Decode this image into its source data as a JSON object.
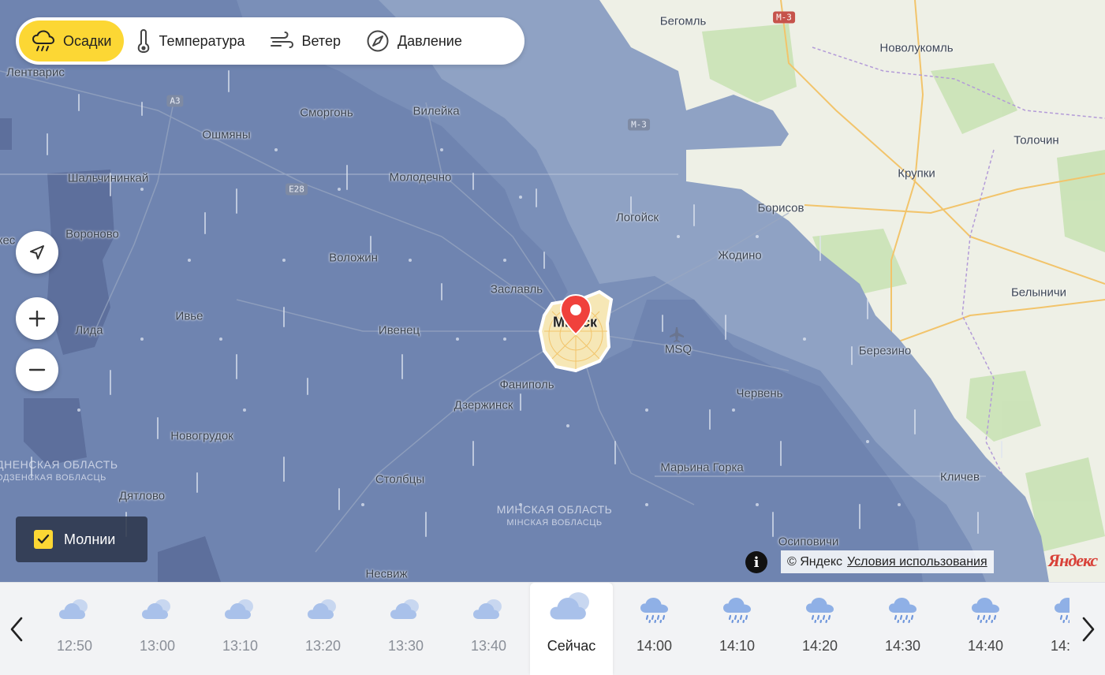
{
  "layers": {
    "precipitation": {
      "label": "Осадки",
      "icon": "rain-cloud-icon",
      "active": true
    },
    "temperature": {
      "label": "Температура",
      "icon": "thermometer-icon"
    },
    "wind": {
      "label": "Ветер",
      "icon": "wind-icon"
    },
    "pressure": {
      "label": "Давление",
      "icon": "pressure-gauge-icon"
    }
  },
  "map": {
    "cities": [
      {
        "name": "Бегомль",
        "key": "begoml"
      },
      {
        "name": "Новолукомль",
        "key": "novolukoml"
      },
      {
        "name": "Лентварис",
        "key": "lentvaris"
      },
      {
        "name": "Сморгонь",
        "key": "smorgon"
      },
      {
        "name": "Вилейка",
        "key": "vileyka"
      },
      {
        "name": "Ошмяны",
        "key": "oshmyany"
      },
      {
        "name": "Шальчининкай",
        "key": "shalchininkai"
      },
      {
        "name": "Молодечно",
        "key": "molodechno"
      },
      {
        "name": "Толочин",
        "key": "tolochin"
      },
      {
        "name": "Крупки",
        "key": "krupki"
      },
      {
        "name": "Борисов",
        "key": "borisov"
      },
      {
        "name": "Логойск",
        "key": "logoysk"
      },
      {
        "name": "Вороново",
        "key": "voronovo"
      },
      {
        "name": "Воложин",
        "key": "volozhin"
      },
      {
        "name": "Жодино",
        "key": "zhodino"
      },
      {
        "name": "Заславль",
        "key": "zaslavl"
      },
      {
        "name": "Минск",
        "key": "minsk"
      },
      {
        "name": "Белыничи",
        "key": "belynichi"
      },
      {
        "name": "Ивье",
        "key": "ivye"
      },
      {
        "name": "Лида",
        "key": "lida"
      },
      {
        "name": "Ивенец",
        "key": "ivenets"
      },
      {
        "name": "MSQ",
        "key": "msq"
      },
      {
        "name": "Березино",
        "key": "berezino"
      },
      {
        "name": "Фаниполь",
        "key": "fanipol"
      },
      {
        "name": "Червень",
        "key": "cherven"
      },
      {
        "name": "Дзержинск",
        "key": "dzerzhinsk"
      },
      {
        "name": "Новогрудок",
        "key": "novogrudok"
      },
      {
        "name": "Марьина Горка",
        "key": "marina"
      },
      {
        "name": "Столбцы",
        "key": "stolbtsy"
      },
      {
        "name": "Кличев",
        "key": "klichev"
      },
      {
        "name": "Дятлово",
        "key": "dyatlovo"
      },
      {
        "name": "Осиповичи",
        "key": "osipovichi"
      },
      {
        "name": "Несвиж",
        "key": "nesvizh"
      },
      {
        "name": "кес",
        "key": "kes"
      }
    ],
    "regions": [
      {
        "text": "Гродненская область",
        "key": "grodno"
      },
      {
        "text": "Гродзенская вобласць",
        "key": "grodno_by"
      },
      {
        "text": "Минская область",
        "key": "minsk_reg"
      },
      {
        "text": "Мінская вобласць",
        "key": "minsk_reg_by"
      }
    ],
    "road_shields": [
      {
        "label": "A3",
        "key": "a3",
        "color": "grey"
      },
      {
        "label": "E28",
        "key": "e28",
        "color": "grey"
      },
      {
        "label": "M-3",
        "key": "m3a",
        "color": "grey"
      },
      {
        "label": "M-3",
        "key": "m3b",
        "color": "red"
      }
    ],
    "colors": {
      "precip_light": "#8fa2c4",
      "precip_medium": "#7186b1",
      "precip_heavy": "#5d6f9c",
      "land": "#eef0e6",
      "forest": "#c9e2b5"
    }
  },
  "controls": {
    "locate_icon": "navigation-arrow-icon",
    "zoom_in_icon": "plus-icon",
    "zoom_out_icon": "minus-icon",
    "lightning_label": "Молнии",
    "lightning_checked": true
  },
  "attribution": {
    "info_symbol": "i",
    "copyright": "© Яндекс",
    "terms": "Условия использования",
    "logo": "Яндекс"
  },
  "timeline": {
    "slots": [
      {
        "time": "12:50",
        "icon": "cloud-icon",
        "state": "past"
      },
      {
        "time": "13:00",
        "icon": "cloud-icon",
        "state": "past"
      },
      {
        "time": "13:10",
        "icon": "cloud-icon",
        "state": "past"
      },
      {
        "time": "13:20",
        "icon": "cloud-icon",
        "state": "past"
      },
      {
        "time": "13:30",
        "icon": "cloud-icon",
        "state": "past"
      },
      {
        "time": "13:40",
        "icon": "cloud-icon",
        "state": "past"
      },
      {
        "time": "Сейчас",
        "icon": "cloud-icon",
        "state": "current"
      },
      {
        "time": "14:00",
        "icon": "rain-cloud-icon",
        "state": "future"
      },
      {
        "time": "14:10",
        "icon": "rain-cloud-icon",
        "state": "future"
      },
      {
        "time": "14:20",
        "icon": "rain-cloud-icon",
        "state": "future"
      },
      {
        "time": "14:30",
        "icon": "rain-cloud-icon",
        "state": "future"
      },
      {
        "time": "14:40",
        "icon": "rain-cloud-icon",
        "state": "future"
      },
      {
        "time": "14:50",
        "icon": "rain-cloud-icon",
        "state": "future"
      }
    ],
    "prev_icon": "chevron-left-icon",
    "next_icon": "chevron-right-icon"
  }
}
